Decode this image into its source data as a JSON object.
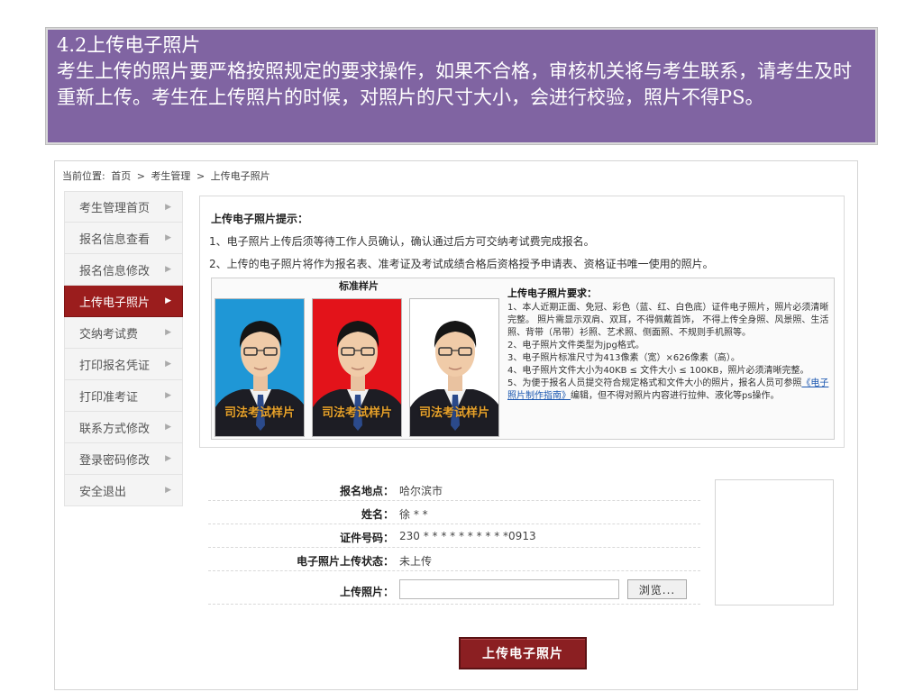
{
  "caption": {
    "title": "4.2上传电子照片",
    "body": "考生上传的照片要严格按照规定的要求操作，如果不合格，审核机关将与考生联系，请考生及时重新上传。考生在上传照片的时候，对照片的尺寸大小，会进行校验，照片不得PS。"
  },
  "breadcrumb": {
    "label": "当前位置:",
    "items": [
      "首页",
      ">",
      "考生管理",
      ">",
      "上传电子照片"
    ]
  },
  "sidebar": {
    "items": [
      {
        "label": "考生管理首页",
        "active": false
      },
      {
        "label": "报名信息查看",
        "active": false
      },
      {
        "label": "报名信息修改",
        "active": false
      },
      {
        "label": "上传电子照片",
        "active": true
      },
      {
        "label": "交纳考试费",
        "active": false
      },
      {
        "label": "打印报名凭证",
        "active": false
      },
      {
        "label": "打印准考证",
        "active": false
      },
      {
        "label": "联系方式修改",
        "active": false
      },
      {
        "label": "登录密码修改",
        "active": false
      },
      {
        "label": "安全退出",
        "active": false
      }
    ]
  },
  "notice": {
    "title": "上传电子照片提示：",
    "line1": "1、电子照片上传后须等待工作人员确认，确认通过后方可交纳考试费完成报名。",
    "line2": "2、上传的电子照片将作为报名表、准考证及考试成绩合格后资格授予申请表、资格证书唯一使用的照片。",
    "sample_header": "标准样片",
    "watermark": "司法考试样片",
    "backgrounds": [
      "#1f97d6",
      "#e3131a",
      "#ffffff"
    ],
    "req_title": "上传电子照片要求：",
    "req1": "1、本人近期正面、免冠、彩色（蓝、红、白色底）证件电子照片，照片必须清晰完整。 照片需显示双肩、双耳，不得佩戴首饰， 不得上传全身照、风景照、生活照、背带（吊带）衫照、艺术照、侧面照、不规则手机照等。",
    "req2": "2、电子照片文件类型为jpg格式。",
    "req3": "3、电子照片标准尺寸为413像素（宽）×626像素（高）。",
    "req4": "4、电子照片文件大小为40KB ≤ 文件大小 ≤ 100KB，照片必须清晰完整。",
    "req5_prefix": "5、为便于报名人员提交符合规定格式和文件大小的照片，报名人员可参照",
    "req5_link": "《电子照片制作指南》",
    "req5_suffix": "编辑，但不得对照片内容进行拉伸、液化等ps操作。"
  },
  "form": {
    "place_label": "报名地点：",
    "place_value": "哈尔滨市",
    "name_label": "姓名：",
    "name_value": "徐 * *",
    "id_label": "证件号码：",
    "id_value": "230 * * * * * * * * * *0913",
    "status_label": "电子照片上传状态：",
    "status_value": "未上传",
    "photo_label": "上传照片：",
    "browse_label": "浏览...",
    "file_value": ""
  },
  "submit": {
    "label": "上传电子照片"
  }
}
